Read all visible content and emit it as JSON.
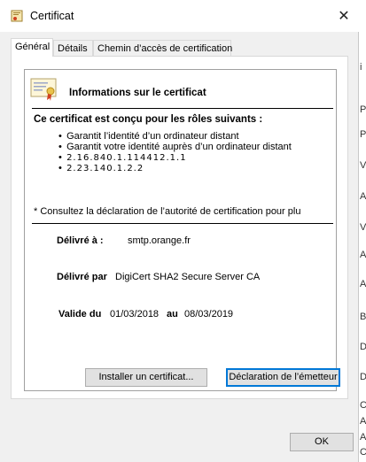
{
  "window": {
    "title": "Certificat",
    "close_symbol": "✕"
  },
  "tabs": [
    {
      "label": "Général",
      "active": true
    },
    {
      "label": "Détails",
      "active": false
    },
    {
      "label": "Chemin d’accès de certification",
      "active": false
    }
  ],
  "panel": {
    "info_title": "Informations sur le certificat",
    "roles_title": "Ce certificat est conçu pour les rôles suivants :",
    "roles": [
      "Garantit l’identité d’un ordinateur distant",
      "Garantit votre identité auprès d’un ordinateur distant",
      "2.16.840.1.114412.1.1",
      "2.23.140.1.2.2"
    ],
    "consult_note": "* Consultez la déclaration de l’autorité de certification pour plu",
    "issued_to_label": "Délivré à :",
    "issued_to_value": "smtp.orange.fr",
    "issued_by_label": "Délivré par",
    "issued_by_value": "DigiCert SHA2 Secure Server CA",
    "valid_from_label": "Valide du",
    "valid_from_value": "01/03/2018",
    "valid_to_label": "au",
    "valid_to_value": "08/03/2019"
  },
  "buttons": {
    "install": "Installer un certificat...",
    "issuer_statement": "Déclaration de l’émetteur",
    "ok": "OK"
  },
  "background_edge_chars": [
    "i",
    "P",
    "P",
    "V",
    "A",
    "V",
    "A",
    "A",
    "B",
    "D",
    "D",
    "C",
    "A",
    "A",
    "C"
  ],
  "colors": {
    "focus_border": "#0078d7",
    "button_bg": "#e1e1e1",
    "dialog_bg": "#f0f0f0"
  }
}
